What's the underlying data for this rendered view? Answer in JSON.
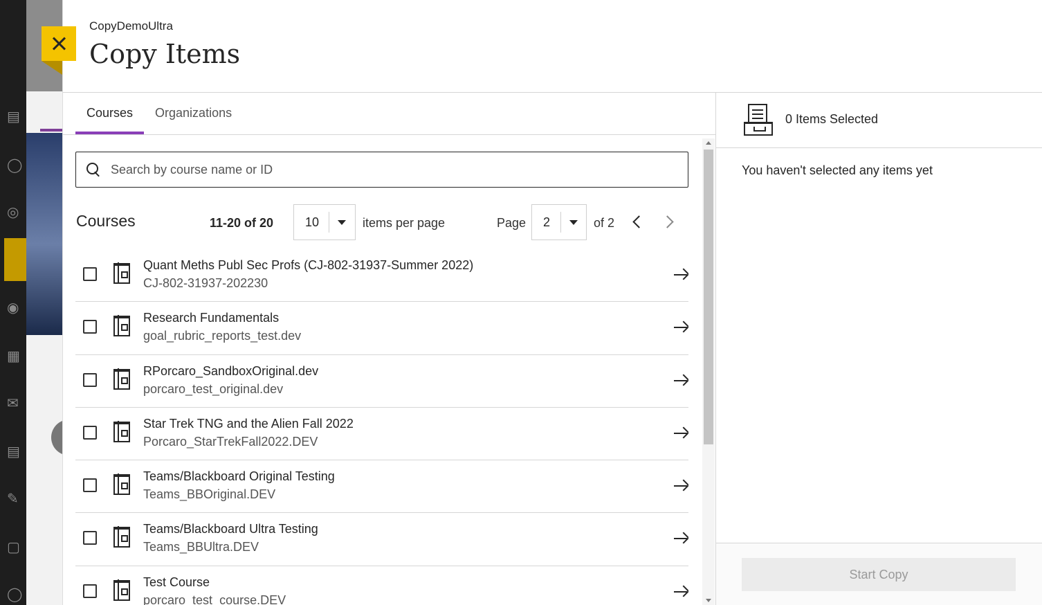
{
  "header": {
    "course_name": "CopyDemoUltra",
    "title": "Copy Items"
  },
  "tabs": [
    {
      "label": "Courses",
      "active": true
    },
    {
      "label": "Organizations",
      "active": false
    }
  ],
  "search": {
    "placeholder": "Search by course name or ID",
    "value": ""
  },
  "list": {
    "title": "Courses",
    "range": "11-20 of 20",
    "per_page_value": "10",
    "per_page_label": "items per page",
    "page_label": "Page",
    "page_value": "2",
    "page_of": "of 2"
  },
  "courses": [
    {
      "title": "Quant Meths Publ Sec Profs (CJ-802-31937-Summer 2022)",
      "id": "CJ-802-31937-202230"
    },
    {
      "title": "Research Fundamentals",
      "id": "goal_rubric_reports_test.dev"
    },
    {
      "title": "RPorcaro_SandboxOriginal.dev",
      "id": "porcaro_test_original.dev"
    },
    {
      "title": "Star Trek TNG and the Alien Fall 2022",
      "id": "Porcaro_StarTrekFall2022.DEV"
    },
    {
      "title": "Teams/Blackboard Original Testing",
      "id": "Teams_BBOriginal.DEV"
    },
    {
      "title": "Teams/Blackboard Ultra Testing",
      "id": "Teams_BBUltra.DEV"
    },
    {
      "title": "Test Course",
      "id": "porcaro_test_course.DEV"
    }
  ],
  "selection": {
    "count_label": "0 Items Selected",
    "empty_message": "You haven't selected any items yet",
    "start_button": "Start Copy"
  },
  "colors": {
    "accent": "#8a3fb8",
    "close_button": "#f4c300"
  }
}
